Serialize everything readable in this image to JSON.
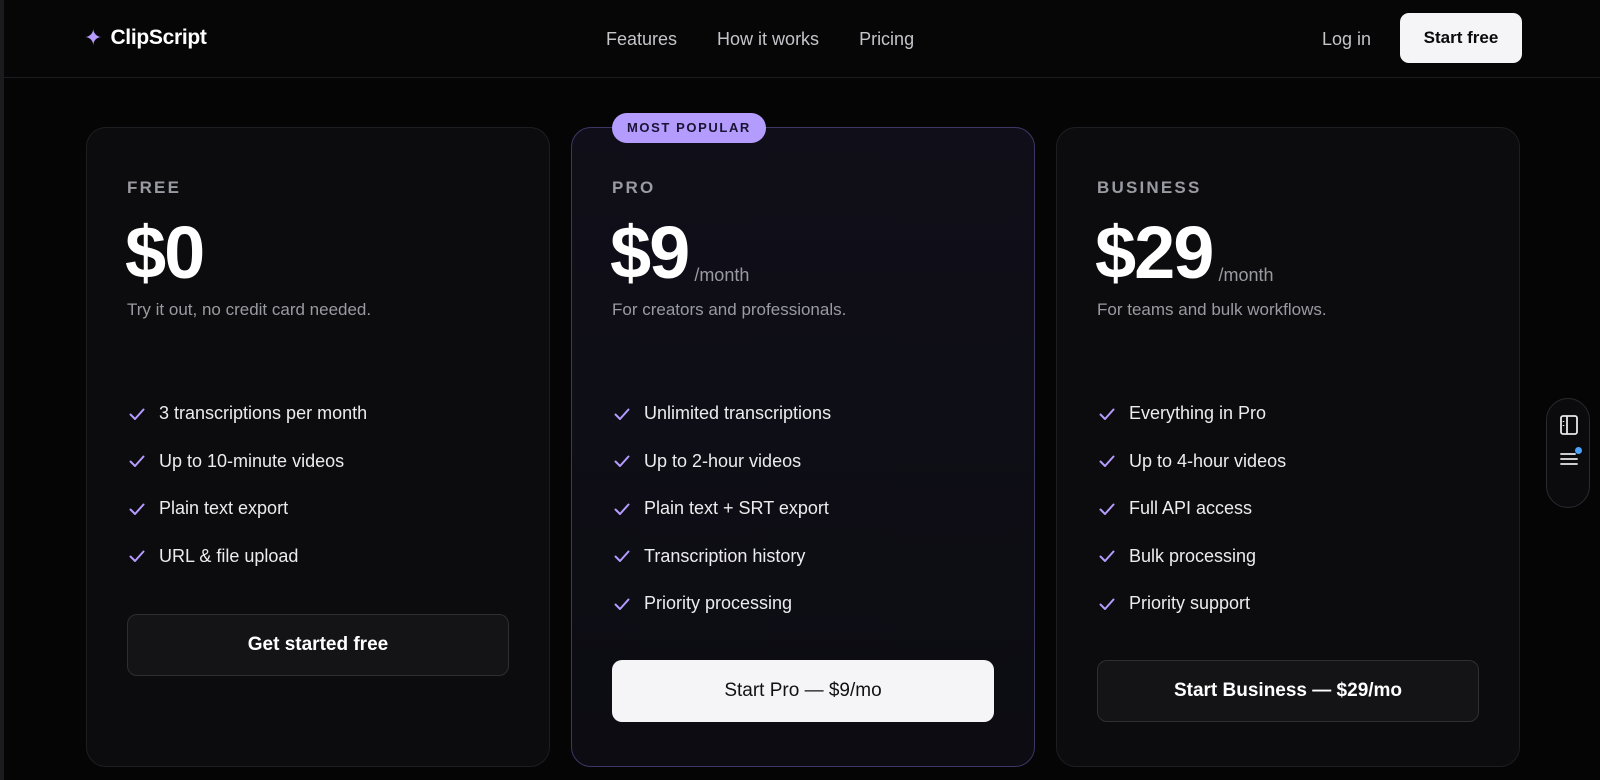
{
  "header": {
    "brand_icon": "sparkle-icon",
    "brand_name": "ClipScript",
    "nav": [
      "Features",
      "How it works",
      "Pricing"
    ],
    "login_label": "Log in",
    "cta_label": "Start free"
  },
  "plans": [
    {
      "name": "FREE",
      "price": "$0",
      "period": "",
      "tagline": "Try it out, no credit card needed.",
      "features": [
        "3 transcriptions per month",
        "Up to 10-minute videos",
        "Plain text export",
        "URL & file upload"
      ],
      "cta": "Get started free"
    },
    {
      "badge": "MOST POPULAR",
      "name": "PRO",
      "price": "$9",
      "period": "/month",
      "tagline": "For creators and professionals.",
      "features": [
        "Unlimited transcriptions",
        "Up to 2-hour videos",
        "Plain text + SRT export",
        "Transcription history",
        "Priority processing"
      ],
      "cta": "Start Pro — $9/mo"
    },
    {
      "name": "BUSINESS",
      "price": "$29",
      "period": "/month",
      "tagline": "For teams and bulk workflows.",
      "features": [
        "Everything in Pro",
        "Up to 4-hour videos",
        "Full API access",
        "Bulk processing",
        "Priority support"
      ],
      "cta": "Start Business — $29/mo"
    }
  ],
  "side_widget": {
    "icons": [
      "sidebar-panel-icon",
      "list-menu-icon"
    ]
  },
  "colors": {
    "accent": "#b49cff",
    "check": "#b49cff",
    "background": "#050506",
    "notification_dot": "#4aa3ff"
  }
}
